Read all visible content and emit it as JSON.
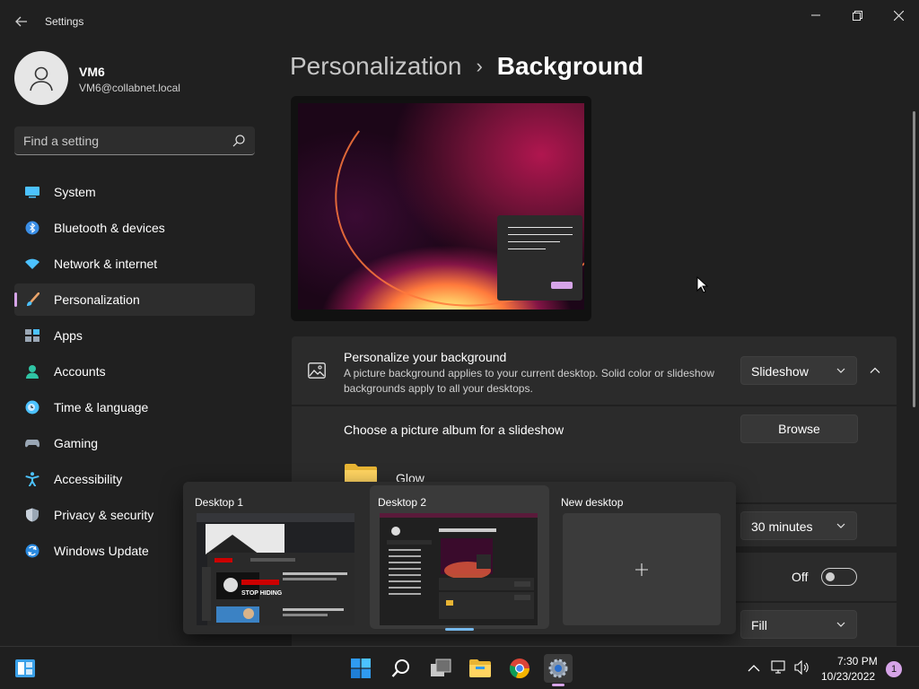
{
  "app": {
    "title": "Settings"
  },
  "user": {
    "name": "VM6",
    "email": "VM6@collabnet.local"
  },
  "search": {
    "placeholder": "Find a setting"
  },
  "sidebar": {
    "items": [
      {
        "label": "System",
        "icon": "system-icon"
      },
      {
        "label": "Bluetooth & devices",
        "icon": "bluetooth-icon"
      },
      {
        "label": "Network & internet",
        "icon": "network-icon"
      },
      {
        "label": "Personalization",
        "icon": "paintbrush-icon",
        "active": true
      },
      {
        "label": "Apps",
        "icon": "apps-icon"
      },
      {
        "label": "Accounts",
        "icon": "accounts-icon"
      },
      {
        "label": "Time & language",
        "icon": "time-language-icon"
      },
      {
        "label": "Gaming",
        "icon": "gaming-icon"
      },
      {
        "label": "Accessibility",
        "icon": "accessibility-icon"
      },
      {
        "label": "Privacy & security",
        "icon": "shield-icon"
      },
      {
        "label": "Windows Update",
        "icon": "windows-update-icon"
      }
    ]
  },
  "breadcrumb": {
    "parent": "Personalization",
    "separator": "›",
    "current": "Background"
  },
  "background": {
    "title": "Personalize your background",
    "description": "A picture background applies to your current desktop. Solid color or slideshow backgrounds apply to all your desktops.",
    "mode": "Slideshow",
    "album_label": "Choose a picture album for a slideshow",
    "browse_label": "Browse",
    "folder_name": "Glow",
    "interval": "30 minutes",
    "shuffle_state": "Off",
    "fit": "Fill"
  },
  "task_view": {
    "desktops": [
      {
        "label": "Desktop 1"
      },
      {
        "label": "Desktop 2",
        "selected": true
      },
      {
        "label": "New desktop"
      }
    ],
    "thumb_text": "STOP HIDING"
  },
  "taskbar": {
    "time": "7:30 PM",
    "date": "10/23/2022",
    "notification_count": "1"
  },
  "colors": {
    "accent": "#d6a4e8",
    "background": "#202020",
    "card": "#2b2b2b",
    "highlight": "#76b9ed"
  }
}
